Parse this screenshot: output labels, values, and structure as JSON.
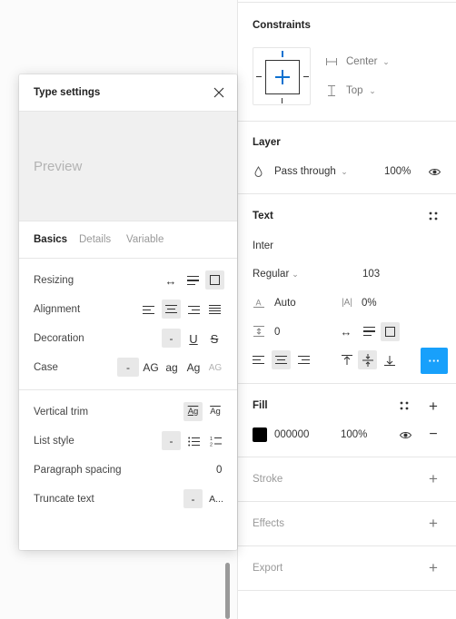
{
  "right_panel": {
    "constraints": {
      "title": "Constraints",
      "horizontal": "Center",
      "vertical": "Top"
    },
    "layer": {
      "title": "Layer",
      "blend_mode": "Pass through",
      "opacity": "100%"
    },
    "text": {
      "title": "Text",
      "font_family": "Inter",
      "font_weight": "Regular",
      "font_size": "103",
      "line_height": "Auto",
      "letter_spacing": "0%",
      "paragraph_spacing": "0",
      "more_label": "···"
    },
    "fill": {
      "title": "Fill",
      "hex": "000000",
      "opacity": "100%",
      "color": "#000000"
    },
    "stroke": {
      "title": "Stroke"
    },
    "effects": {
      "title": "Effects"
    },
    "export": {
      "title": "Export"
    }
  },
  "type_settings": {
    "title": "Type settings",
    "preview": "Preview",
    "tabs": [
      "Basics",
      "Details",
      "Variable"
    ],
    "rows": {
      "resizing": "Resizing",
      "alignment": "Alignment",
      "decoration": "Decoration",
      "case": "Case",
      "vertical_trim": "Vertical trim",
      "list_style": "List style",
      "paragraph_spacing": "Paragraph spacing",
      "truncate_text": "Truncate text"
    },
    "values": {
      "paragraph_spacing": "0",
      "none_dash": "-",
      "case_upper": "AG",
      "case_lower": "ag",
      "case_title": "Ag",
      "case_smallcaps": "AG",
      "trim_glyph": "Ag",
      "truncate_ellipsis": "A..."
    }
  },
  "colors": {
    "accent": "#18a0fb",
    "constraint_blue": "#0d71d0"
  }
}
